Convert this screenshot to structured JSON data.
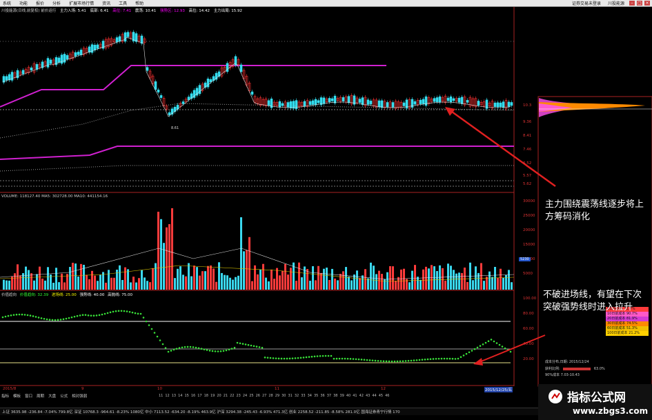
{
  "menubar": {
    "items": [
      "系统",
      "功能",
      "报价",
      "分析",
      "扩展市场行情",
      "资讯",
      "工具",
      "帮助"
    ],
    "right": [
      "证券交易未登录",
      "川投能源"
    ]
  },
  "kline_header": {
    "title": "川投能源(日线,前复权) 前价运行",
    "items": [
      "主力入场: 5.41",
      "底部: 6.41",
      "高位: 7.41",
      "震荡: 10.41",
      "强势区: 12.93",
      "高位: 14.42",
      "主力出局: 15.92"
    ]
  },
  "price_axis": [
    "10.3",
    "9.36",
    "8.41",
    "7.46",
    "6.52",
    "5.57",
    "5.62"
  ],
  "kline_annot": {
    "low_label": "8.61"
  },
  "volume_header": "VOLUME: 118127.40  MA5: 302728.00  MA10: 441154.16",
  "volume_axis": [
    "30000",
    "25000",
    "20000",
    "15000",
    "10000",
    "5000",
    "5230"
  ],
  "indicator_header": [
    "价值趋向",
    "价值趋向: 32.39",
    "进场线: 25.00",
    "强势线: 40.00",
    "高抛线: 75.00"
  ],
  "indicator_axis": [
    "100.00",
    "80.00",
    "60.00",
    "40.00",
    "20.00"
  ],
  "chip_panel": {
    "items": [
      "5日前成本 11.7%",
      "10日前成本 90.7%",
      "20日前成本 81.9%",
      "30日前成本 74.5%",
      "60日前成本 51.3%",
      "100日前成本 21.2%"
    ],
    "colors": [
      "#ff3b3b",
      "#ff59c8",
      "#d43bd4",
      "#ff8a00",
      "#f0c000",
      "#ffd000"
    ],
    "footer1": "成本分布,日期: 2015/12/24",
    "footer2": "获利比例:",
    "footer2_val": "63.0%",
    "footer3": "90%成本 7.03-10.43"
  },
  "annotations": {
    "a1": "主力围绕震荡线逐步将上方筹码消化",
    "a2": "不破进场线，有望在下次突破强势线时进入拉升"
  },
  "date_axis": [
    "2015/8",
    "9",
    "10",
    "11",
    "12",
    "2015/12/25/五"
  ],
  "tabs": [
    "指标",
    "模板",
    "窗口",
    "周期",
    "大盘",
    "公式",
    "相对强弱"
  ],
  "numbers": [
    "11",
    "12",
    "13",
    "14",
    "15",
    "16",
    "17",
    "18",
    "19",
    "20",
    "21",
    "22",
    "23",
    "24",
    "25",
    "26",
    "27",
    "28",
    "29",
    "30",
    "31",
    "32",
    "33",
    "34",
    "35",
    "36",
    "37",
    "38",
    "39",
    "40",
    "41",
    "42",
    "43",
    "44",
    "45",
    "46"
  ],
  "status_bar": "上证 3635.98 -236.84 -7.04% 799.8亿   深证 10768.3 -964.61 -8.23% 1080亿   中小 7113.52 -634.20 -8.19% 463.9亿   沪深 3294.38 -245.43 -6.93% 471.3亿   创业 2258.52 -211.85 -8.58% 281.0亿   国海证券青宁行情 170",
  "watermark": {
    "title": "指标公式网",
    "url": "www.zbgs3.com"
  }
}
